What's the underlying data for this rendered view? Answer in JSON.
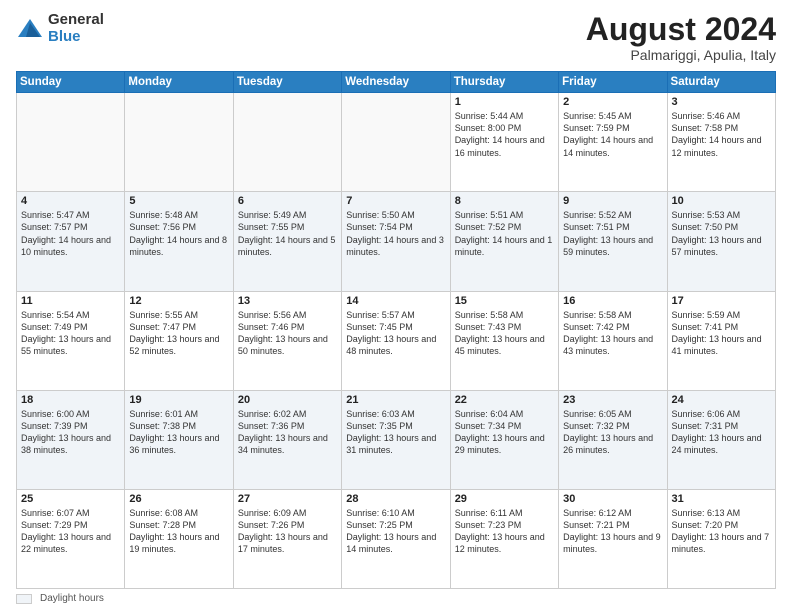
{
  "header": {
    "logo_general": "General",
    "logo_blue": "Blue",
    "month_year": "August 2024",
    "location": "Palmariggi, Apulia, Italy"
  },
  "footer": {
    "daylight_label": "Daylight hours"
  },
  "days_of_week": [
    "Sunday",
    "Monday",
    "Tuesday",
    "Wednesday",
    "Thursday",
    "Friday",
    "Saturday"
  ],
  "weeks": [
    [
      {
        "day": "",
        "info": ""
      },
      {
        "day": "",
        "info": ""
      },
      {
        "day": "",
        "info": ""
      },
      {
        "day": "",
        "info": ""
      },
      {
        "day": "1",
        "info": "Sunrise: 5:44 AM\nSunset: 8:00 PM\nDaylight: 14 hours\nand 16 minutes."
      },
      {
        "day": "2",
        "info": "Sunrise: 5:45 AM\nSunset: 7:59 PM\nDaylight: 14 hours\nand 14 minutes."
      },
      {
        "day": "3",
        "info": "Sunrise: 5:46 AM\nSunset: 7:58 PM\nDaylight: 14 hours\nand 12 minutes."
      }
    ],
    [
      {
        "day": "4",
        "info": "Sunrise: 5:47 AM\nSunset: 7:57 PM\nDaylight: 14 hours\nand 10 minutes."
      },
      {
        "day": "5",
        "info": "Sunrise: 5:48 AM\nSunset: 7:56 PM\nDaylight: 14 hours\nand 8 minutes."
      },
      {
        "day": "6",
        "info": "Sunrise: 5:49 AM\nSunset: 7:55 PM\nDaylight: 14 hours\nand 5 minutes."
      },
      {
        "day": "7",
        "info": "Sunrise: 5:50 AM\nSunset: 7:54 PM\nDaylight: 14 hours\nand 3 minutes."
      },
      {
        "day": "8",
        "info": "Sunrise: 5:51 AM\nSunset: 7:52 PM\nDaylight: 14 hours\nand 1 minute."
      },
      {
        "day": "9",
        "info": "Sunrise: 5:52 AM\nSunset: 7:51 PM\nDaylight: 13 hours\nand 59 minutes."
      },
      {
        "day": "10",
        "info": "Sunrise: 5:53 AM\nSunset: 7:50 PM\nDaylight: 13 hours\nand 57 minutes."
      }
    ],
    [
      {
        "day": "11",
        "info": "Sunrise: 5:54 AM\nSunset: 7:49 PM\nDaylight: 13 hours\nand 55 minutes."
      },
      {
        "day": "12",
        "info": "Sunrise: 5:55 AM\nSunset: 7:47 PM\nDaylight: 13 hours\nand 52 minutes."
      },
      {
        "day": "13",
        "info": "Sunrise: 5:56 AM\nSunset: 7:46 PM\nDaylight: 13 hours\nand 50 minutes."
      },
      {
        "day": "14",
        "info": "Sunrise: 5:57 AM\nSunset: 7:45 PM\nDaylight: 13 hours\nand 48 minutes."
      },
      {
        "day": "15",
        "info": "Sunrise: 5:58 AM\nSunset: 7:43 PM\nDaylight: 13 hours\nand 45 minutes."
      },
      {
        "day": "16",
        "info": "Sunrise: 5:58 AM\nSunset: 7:42 PM\nDaylight: 13 hours\nand 43 minutes."
      },
      {
        "day": "17",
        "info": "Sunrise: 5:59 AM\nSunset: 7:41 PM\nDaylight: 13 hours\nand 41 minutes."
      }
    ],
    [
      {
        "day": "18",
        "info": "Sunrise: 6:00 AM\nSunset: 7:39 PM\nDaylight: 13 hours\nand 38 minutes."
      },
      {
        "day": "19",
        "info": "Sunrise: 6:01 AM\nSunset: 7:38 PM\nDaylight: 13 hours\nand 36 minutes."
      },
      {
        "day": "20",
        "info": "Sunrise: 6:02 AM\nSunset: 7:36 PM\nDaylight: 13 hours\nand 34 minutes."
      },
      {
        "day": "21",
        "info": "Sunrise: 6:03 AM\nSunset: 7:35 PM\nDaylight: 13 hours\nand 31 minutes."
      },
      {
        "day": "22",
        "info": "Sunrise: 6:04 AM\nSunset: 7:34 PM\nDaylight: 13 hours\nand 29 minutes."
      },
      {
        "day": "23",
        "info": "Sunrise: 6:05 AM\nSunset: 7:32 PM\nDaylight: 13 hours\nand 26 minutes."
      },
      {
        "day": "24",
        "info": "Sunrise: 6:06 AM\nSunset: 7:31 PM\nDaylight: 13 hours\nand 24 minutes."
      }
    ],
    [
      {
        "day": "25",
        "info": "Sunrise: 6:07 AM\nSunset: 7:29 PM\nDaylight: 13 hours\nand 22 minutes."
      },
      {
        "day": "26",
        "info": "Sunrise: 6:08 AM\nSunset: 7:28 PM\nDaylight: 13 hours\nand 19 minutes."
      },
      {
        "day": "27",
        "info": "Sunrise: 6:09 AM\nSunset: 7:26 PM\nDaylight: 13 hours\nand 17 minutes."
      },
      {
        "day": "28",
        "info": "Sunrise: 6:10 AM\nSunset: 7:25 PM\nDaylight: 13 hours\nand 14 minutes."
      },
      {
        "day": "29",
        "info": "Sunrise: 6:11 AM\nSunset: 7:23 PM\nDaylight: 13 hours\nand 12 minutes."
      },
      {
        "day": "30",
        "info": "Sunrise: 6:12 AM\nSunset: 7:21 PM\nDaylight: 13 hours\nand 9 minutes."
      },
      {
        "day": "31",
        "info": "Sunrise: 6:13 AM\nSunset: 7:20 PM\nDaylight: 13 hours\nand 7 minutes."
      }
    ]
  ]
}
